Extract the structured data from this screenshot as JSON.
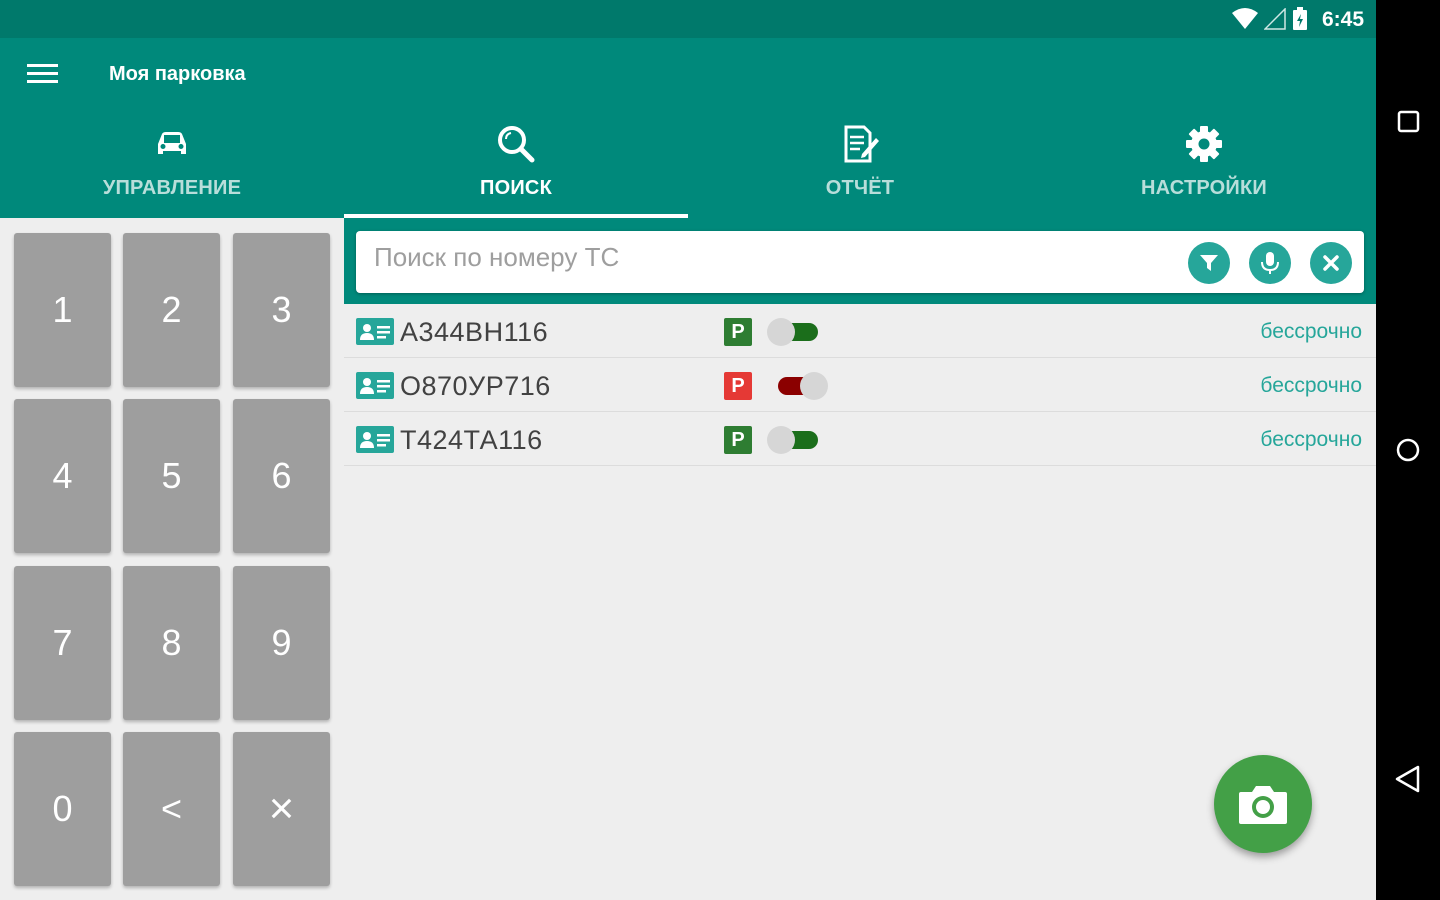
{
  "status_bar": {
    "time": "6:45",
    "icons": [
      "wifi-icon",
      "signal-icon",
      "battery-icon"
    ]
  },
  "app_bar": {
    "title": "Моя парковка"
  },
  "tabs": [
    {
      "label": "УПРАВЛЕНИЕ",
      "icon": "car-icon",
      "active": false
    },
    {
      "label": "ПОИСК",
      "icon": "search-icon",
      "active": true
    },
    {
      "label": "ОТЧЁТ",
      "icon": "report-icon",
      "active": false
    },
    {
      "label": "НАСТРОЙКИ",
      "icon": "gear-icon",
      "active": false
    }
  ],
  "keypad": {
    "keys": [
      "1",
      "2",
      "3",
      "4",
      "5",
      "6",
      "7",
      "8",
      "9",
      "0",
      "<",
      "×"
    ]
  },
  "search": {
    "placeholder": "Поиск по номеру ТС",
    "value": "",
    "buttons": [
      "filter-icon",
      "microphone-icon",
      "clear-icon"
    ]
  },
  "results": [
    {
      "plate": "А344ВН116",
      "badge": "P",
      "badge_color": "#2e7d32",
      "toggle_on": true,
      "expiry": "бессрочно"
    },
    {
      "plate": "О870УР716",
      "badge": "P",
      "badge_color": "#e53935",
      "toggle_on": false,
      "expiry": "бессрочно"
    },
    {
      "plate": "Т424ТА116",
      "badge": "P",
      "badge_color": "#2e7d32",
      "toggle_on": true,
      "expiry": "бессрочно"
    }
  ],
  "colors": {
    "primary": "#00897b",
    "primary_dark": "#00796b",
    "accent": "#26a69a",
    "fab": "#43a047",
    "toggle_on": "#1b6e1b",
    "toggle_off": "#8b0000"
  },
  "fab": {
    "icon": "camera-icon"
  },
  "nav_bar": {
    "buttons": [
      "recents-icon",
      "home-icon",
      "back-icon"
    ]
  }
}
